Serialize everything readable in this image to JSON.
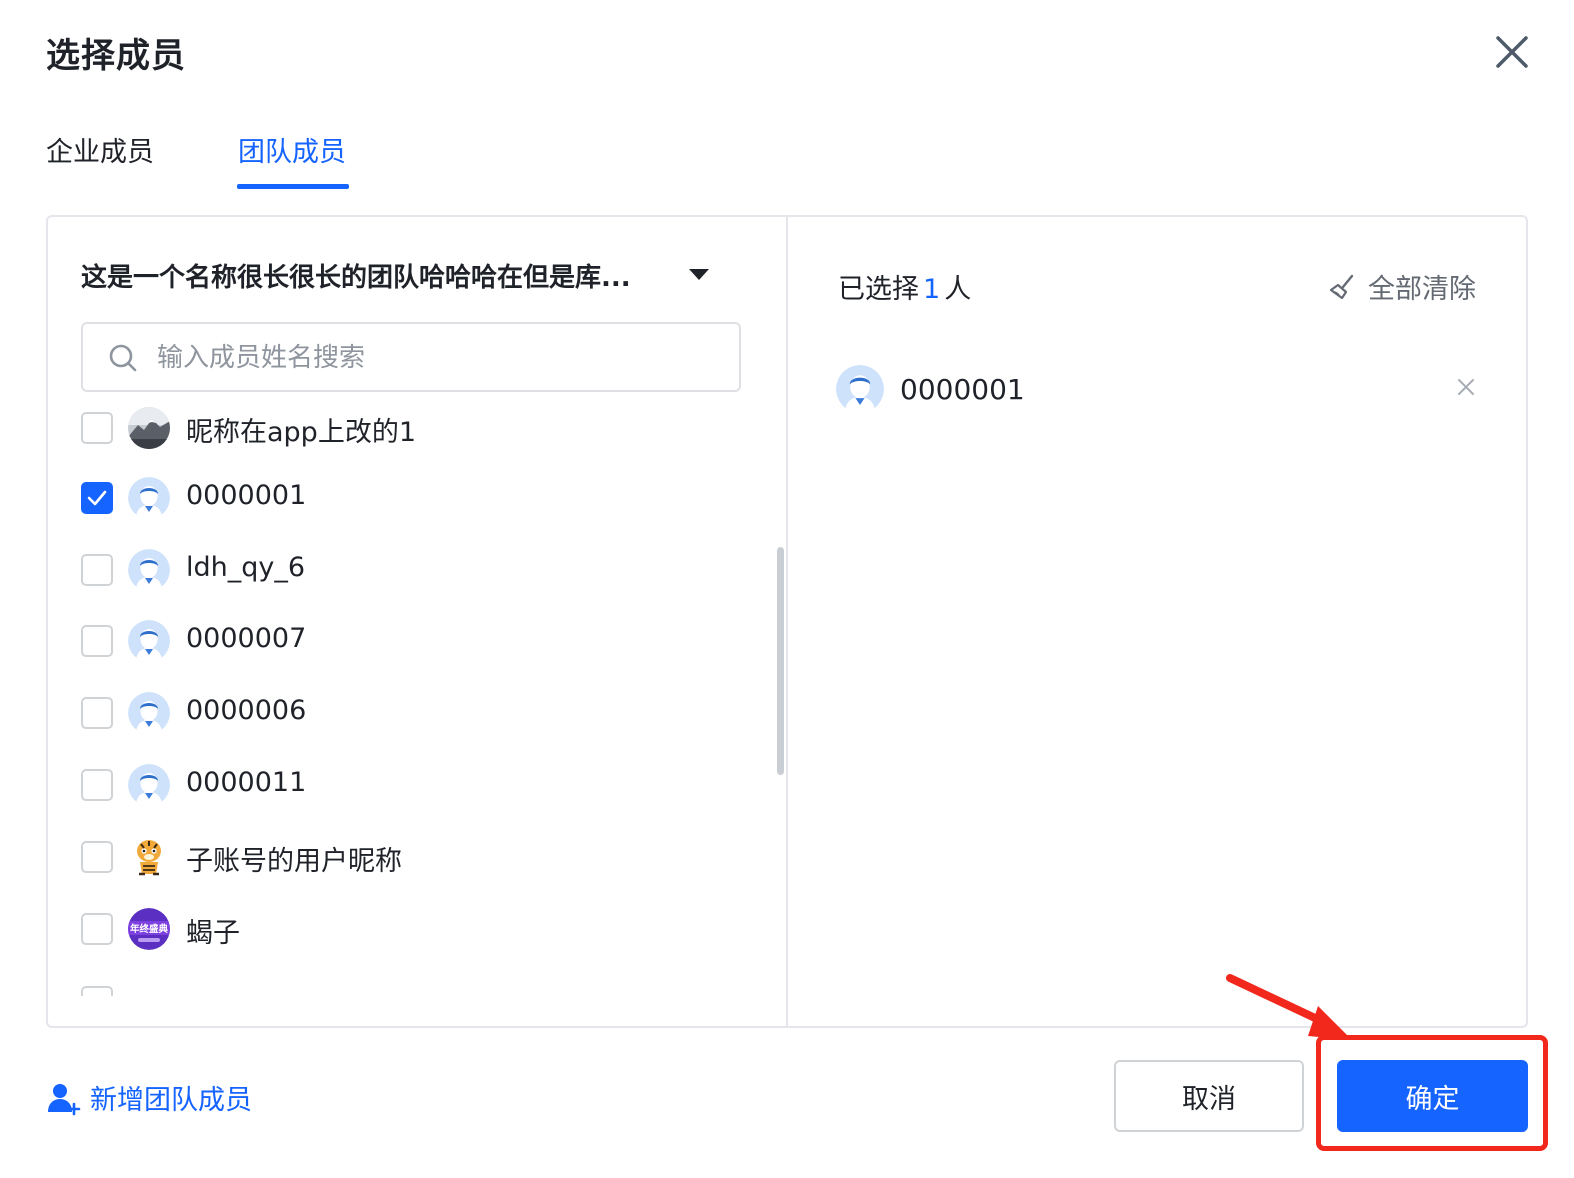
{
  "dialog": {
    "title": "选择成员"
  },
  "tabs": [
    {
      "label": "企业成员",
      "active": false
    },
    {
      "label": "团队成员",
      "active": true
    }
  ],
  "left_panel": {
    "team_name": "这是一个名称很长很长的团队哈哈哈在但是库...",
    "search": {
      "placeholder": "输入成员姓名搜索",
      "value": ""
    },
    "members": [
      {
        "name": "昵称在app上改的1",
        "checked": false,
        "avatar": "mountain-photo-avatar"
      },
      {
        "name": "0000001",
        "checked": true,
        "avatar": "default-user-avatar"
      },
      {
        "name": "ldh_qy_6",
        "checked": false,
        "avatar": "default-user-avatar"
      },
      {
        "name": "0000007",
        "checked": false,
        "avatar": "default-user-avatar"
      },
      {
        "name": "0000006",
        "checked": false,
        "avatar": "default-user-avatar"
      },
      {
        "name": "0000011",
        "checked": false,
        "avatar": "default-user-avatar"
      },
      {
        "name": "子账号的用户昵称",
        "checked": false,
        "avatar": "tiger-cartoon-avatar"
      },
      {
        "name": "蝎子",
        "checked": false,
        "avatar": "purple-banner-avatar",
        "avatar_text": "年终盛典"
      }
    ]
  },
  "right_panel": {
    "selected_prefix": "已选择",
    "selected_count": "1",
    "selected_suffix": "人",
    "clear_all_label": "全部清除",
    "selected": [
      {
        "name": "0000001",
        "avatar": "default-user-avatar"
      }
    ]
  },
  "footer": {
    "add_member_label": "新增团队成员",
    "cancel_label": "取消",
    "confirm_label": "确定"
  },
  "colors": {
    "primary": "#1664ff",
    "text": "#1f2329",
    "muted": "#8f959e",
    "border": "#e4e6eb",
    "annotation": "#f2281c"
  }
}
